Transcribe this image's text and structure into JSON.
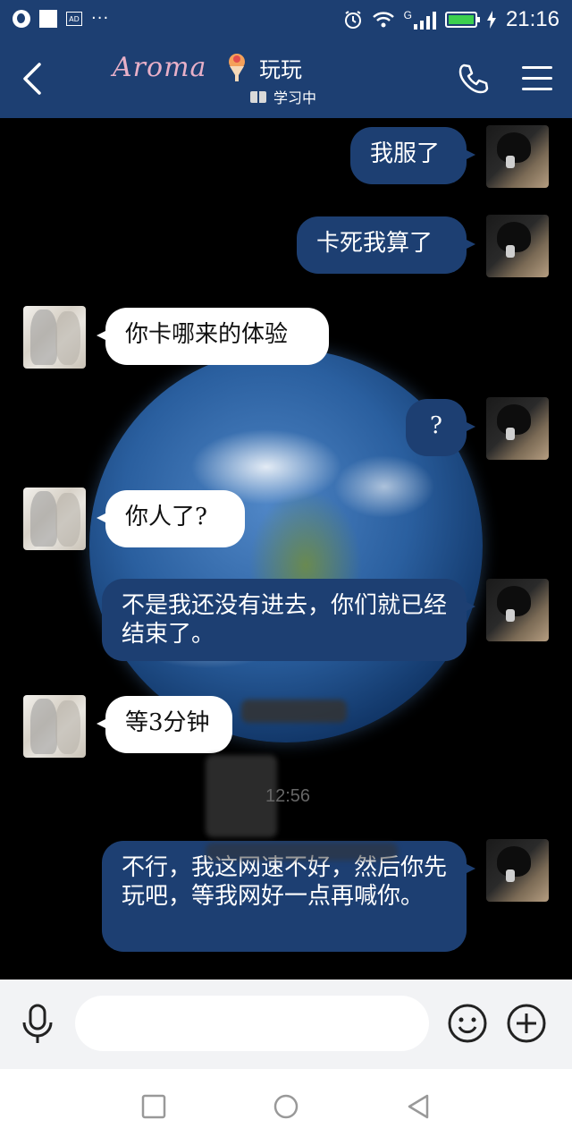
{
  "status_bar": {
    "ad_label": "AD",
    "more": "···",
    "network": "G",
    "time": "21:16",
    "battery_color": "#3ccf4e"
  },
  "header": {
    "brand": "Aroma",
    "title": "玩玩",
    "status": "学习中",
    "bg_color": "#1d3f72"
  },
  "messages": [
    {
      "side": "me",
      "text": "我服了"
    },
    {
      "side": "me",
      "text": "卡死我算了"
    },
    {
      "side": "other",
      "text": "你卡哪来的体验"
    },
    {
      "side": "me",
      "text": "?"
    },
    {
      "side": "other",
      "text": "你人了?"
    },
    {
      "side": "me",
      "text": "不是我还没有进去，你们就已经结束了。"
    },
    {
      "side": "other",
      "text": "等3分钟"
    },
    {
      "side": "me",
      "text": "不行，我这网速不好，然后你先玩吧，等我网好一点再喊你。"
    }
  ],
  "timestamp": "12:56",
  "input": {
    "placeholder": ""
  },
  "icons": [
    "globe-icon",
    "app-icon",
    "ad-icon",
    "alarm-icon",
    "wifi-icon",
    "signal-icon",
    "battery-icon",
    "back-icon",
    "dessert-icon",
    "book-icon",
    "phone-icon",
    "menu-icon",
    "mic-icon",
    "emoji-icon",
    "plus-icon",
    "recents-icon",
    "home-icon",
    "back-nav-icon"
  ]
}
